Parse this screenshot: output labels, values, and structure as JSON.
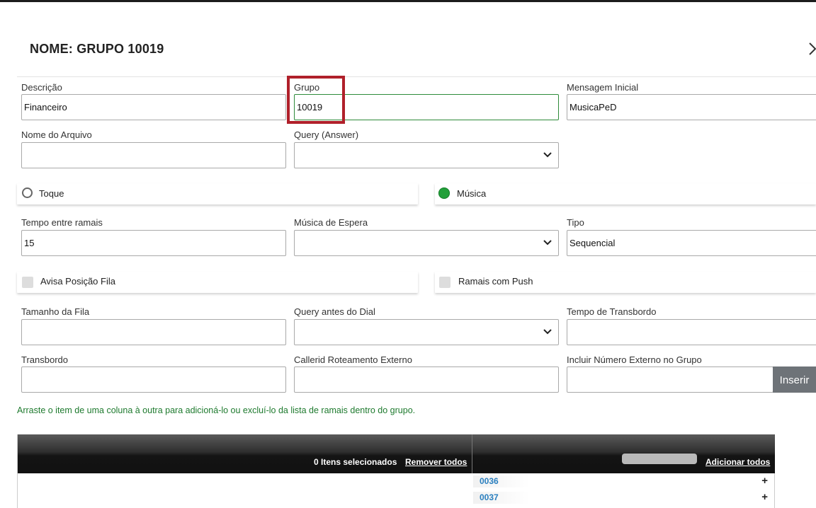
{
  "modal": {
    "title": "NOME: GRUPO 10019"
  },
  "fields": {
    "descricao": {
      "label": "Descrição",
      "value": "Financeiro"
    },
    "grupo": {
      "label": "Grupo",
      "value": "10019"
    },
    "mensagem_inicial": {
      "label": "Mensagem Inicial",
      "value": "MusicaPeD"
    },
    "nome_arquivo": {
      "label": "Nome do Arquivo",
      "value": ""
    },
    "query_answer": {
      "label": "Query (Answer)",
      "value": ""
    },
    "tempo_entre_ramais": {
      "label": "Tempo entre ramais",
      "value": "15"
    },
    "musica_espera": {
      "label": "Música de Espera",
      "value": ""
    },
    "tipo": {
      "label": "Tipo",
      "value": "Sequencial"
    },
    "tamanho_fila": {
      "label": "Tamanho da Fila",
      "value": ""
    },
    "query_antes_dial": {
      "label": "Query antes do Dial",
      "value": ""
    },
    "tempo_transbordo": {
      "label": "Tempo de Transbordo",
      "value": ""
    },
    "transbordo": {
      "label": "Transbordo",
      "value": ""
    },
    "callerid_roteamento": {
      "label": "Callerid Roteamento Externo",
      "value": ""
    },
    "numero_externo": {
      "label": "Incluir Número Externo no Grupo",
      "value": ""
    }
  },
  "radios": {
    "toque": {
      "label": "Toque",
      "selected": false
    },
    "musica": {
      "label": "Música",
      "selected": true
    }
  },
  "checkboxes": {
    "avisa_posicao": {
      "label": "Avisa Posição Fila",
      "checked": false
    },
    "ramais_push": {
      "label": "Ramais com Push",
      "checked": false
    }
  },
  "buttons": {
    "inserir": "Inserir"
  },
  "hint": "Arraste o item de uma coluna à  outra para adicioná-lo ou excluí-lo da lista de ramais dentro do grupo.",
  "selected_panel": {
    "count_label": "0 Itens selecionados",
    "remove_all": "Remover todos"
  },
  "available_panel": {
    "add_all": "Adicionar todos",
    "items": [
      {
        "code": "0036",
        "action": "+"
      },
      {
        "code": "0037",
        "action": "+"
      }
    ]
  },
  "colors": {
    "accent_green": "#22a03a",
    "highlight_red": "#b0202a",
    "link_blue": "#2a7fbf",
    "hint_green": "#1e7a2e"
  }
}
